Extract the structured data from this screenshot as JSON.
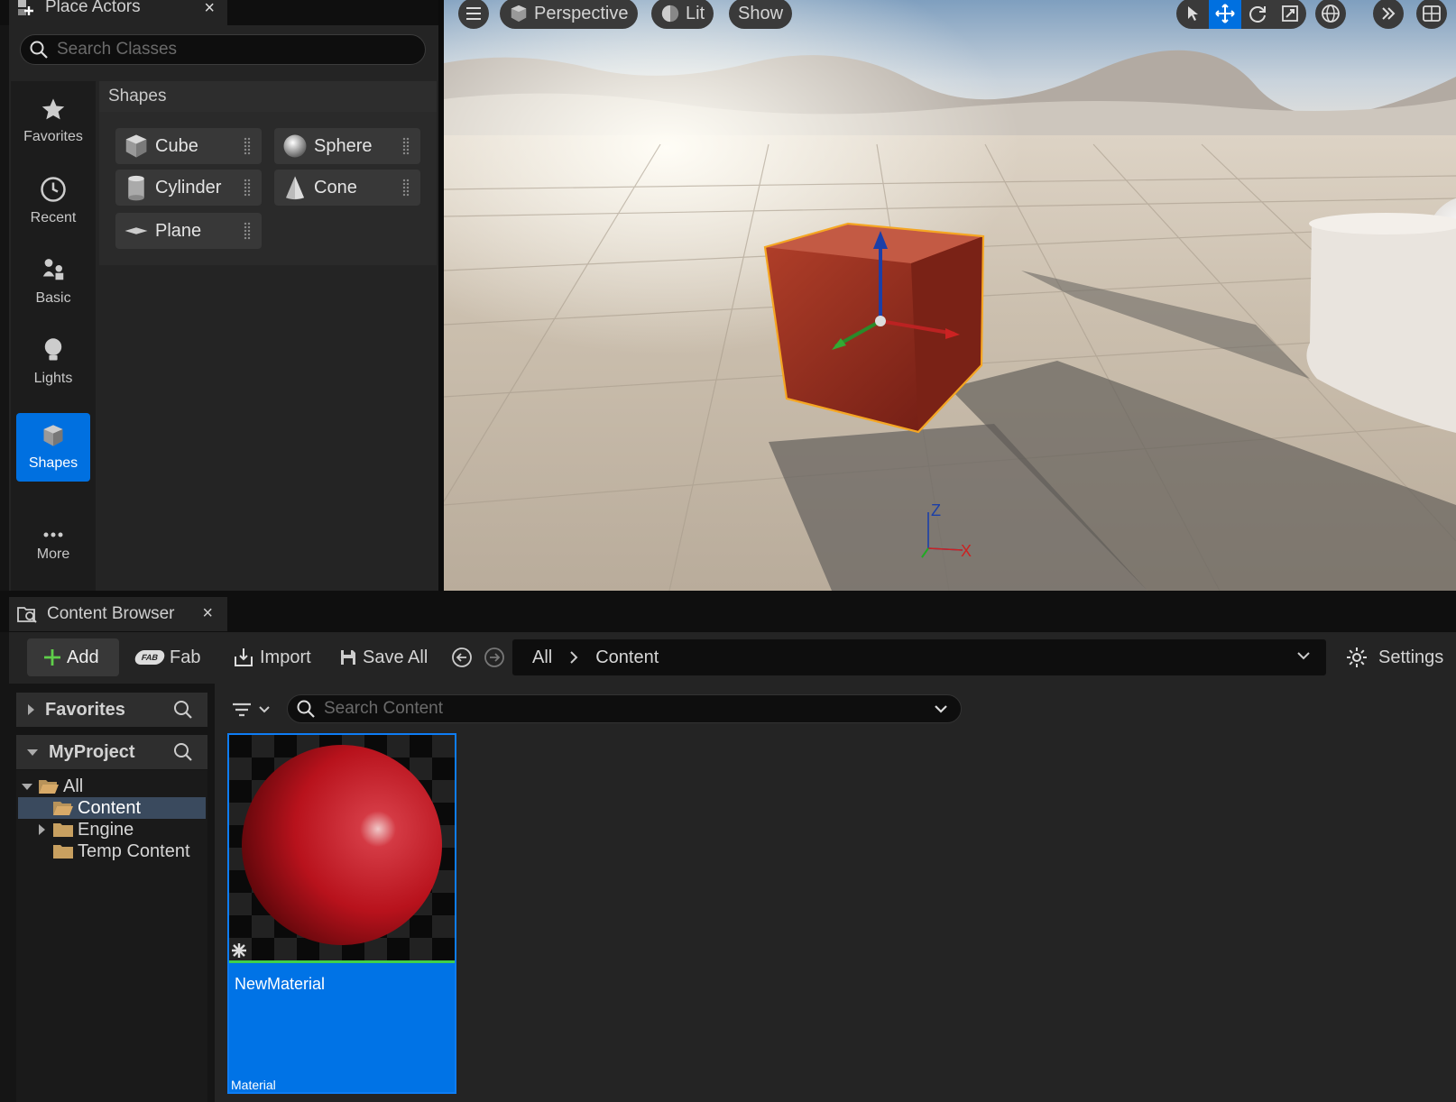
{
  "place_actors": {
    "tab_title": "Place Actors",
    "close": "×",
    "search_placeholder": "Search Classes",
    "categories": [
      {
        "label": "Favorites",
        "icon": "star-icon"
      },
      {
        "label": "Recent",
        "icon": "clock-icon"
      },
      {
        "label": "Basic",
        "icon": "basic-actors-icon"
      },
      {
        "label": "Lights",
        "icon": "lightbulb-icon"
      },
      {
        "label": "Shapes",
        "icon": "cube-icon",
        "selected": true
      },
      {
        "label": "More",
        "icon": "more-dots-icon"
      }
    ],
    "section_title": "Shapes",
    "shapes": [
      {
        "label": "Cube",
        "icon": "cube-shape-icon"
      },
      {
        "label": "Sphere",
        "icon": "sphere-shape-icon"
      },
      {
        "label": "Cylinder",
        "icon": "cylinder-shape-icon"
      },
      {
        "label": "Cone",
        "icon": "cone-shape-icon"
      },
      {
        "label": "Plane",
        "icon": "plane-shape-icon"
      }
    ]
  },
  "viewport": {
    "perspective_label": "Perspective",
    "lit_label": "Lit",
    "show_label": "Show",
    "axis_z": "Z",
    "axis_x": "X",
    "transform_tools": [
      "select-icon",
      "move-icon",
      "rotate-icon",
      "scale-icon"
    ],
    "selection_color": "#f5a623"
  },
  "content_browser": {
    "tab_title": "Content Browser",
    "close": "×",
    "toolbar": {
      "add": "Add",
      "fab": "Fab",
      "fab_logo": "FAB",
      "import": "Import",
      "save_all": "Save All",
      "settings": "Settings"
    },
    "breadcrumb": [
      "All",
      "Content"
    ],
    "favorites_label": "Favorites",
    "project_label": "MyProject",
    "tree": [
      {
        "label": "All",
        "expanded": true
      },
      {
        "label": "Content",
        "selected": true
      },
      {
        "label": "Engine",
        "collapsed": true
      },
      {
        "label": "Temp Content"
      }
    ],
    "search_placeholder": "Search Content",
    "assets": [
      {
        "name": "NewMaterial",
        "type": "Material",
        "color": "#c0141c"
      }
    ]
  },
  "colors": {
    "accent": "#0070e0",
    "asset_bar": "#3fcf4a",
    "folder": "#c8a060"
  }
}
